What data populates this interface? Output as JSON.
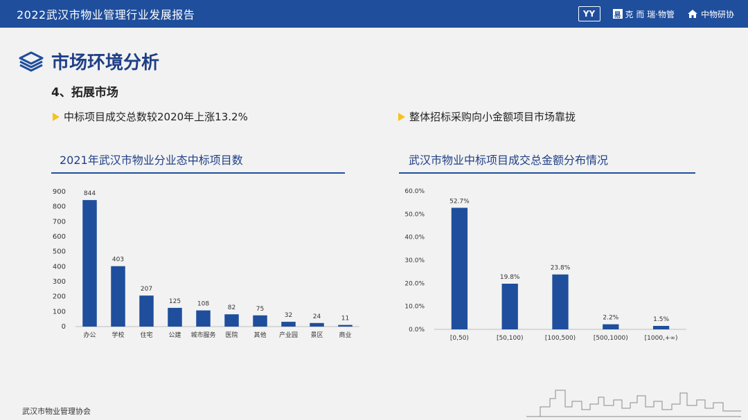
{
  "header": {
    "title": "2022武汉市物业管理行业发展报告",
    "logos": [
      {
        "name": "yy-logo",
        "text": "YY"
      },
      {
        "name": "partner-logo",
        "text": "克 而 瑞·物管"
      },
      {
        "name": "zhongwu-logo",
        "text": "中物研协"
      }
    ]
  },
  "section": {
    "title": "市场环境分析",
    "subtitle": "4、拓展市场"
  },
  "bullets": {
    "left": "中标项目成交总数较2020年上涨13.2%",
    "right": "整体招标采购向小金额项目市场靠拢"
  },
  "chart_data": [
    {
      "type": "bar",
      "title": "2021年武汉市物业分业态中标项目数",
      "categories": [
        "办公",
        "学校",
        "住宅",
        "公建",
        "城市服务",
        "医院",
        "其他",
        "产业园",
        "景区",
        "商业"
      ],
      "values": [
        844,
        403,
        207,
        125,
        108,
        82,
        75,
        32,
        24,
        11
      ],
      "value_labels": [
        "844",
        "403",
        "207",
        "125",
        "108",
        "82",
        "75",
        "32",
        "24",
        "11"
      ],
      "yticks": [
        "0",
        "100",
        "200",
        "300",
        "400",
        "500",
        "600",
        "700",
        "800",
        "900"
      ],
      "ylim": [
        0,
        900
      ],
      "grid": false,
      "color": "#1f4e9c"
    },
    {
      "type": "bar",
      "title": "武汉市物业中标项目成交总金额分布情况",
      "categories": [
        "[0,50)",
        "[50,100)",
        "[100,500)",
        "[500,1000)",
        "[1000,+∞)"
      ],
      "values": [
        52.7,
        19.8,
        23.8,
        2.2,
        1.5
      ],
      "value_labels": [
        "52.7%",
        "19.8%",
        "23.8%",
        "2.2%",
        "1.5%"
      ],
      "yticks": [
        "0.0%",
        "10.0%",
        "20.0%",
        "30.0%",
        "40.0%",
        "50.0%",
        "60.0%"
      ],
      "ylim": [
        0,
        60
      ],
      "grid": false,
      "color": "#1f4e9c"
    }
  ],
  "footer": {
    "org": "武汉市物业管理协会"
  }
}
